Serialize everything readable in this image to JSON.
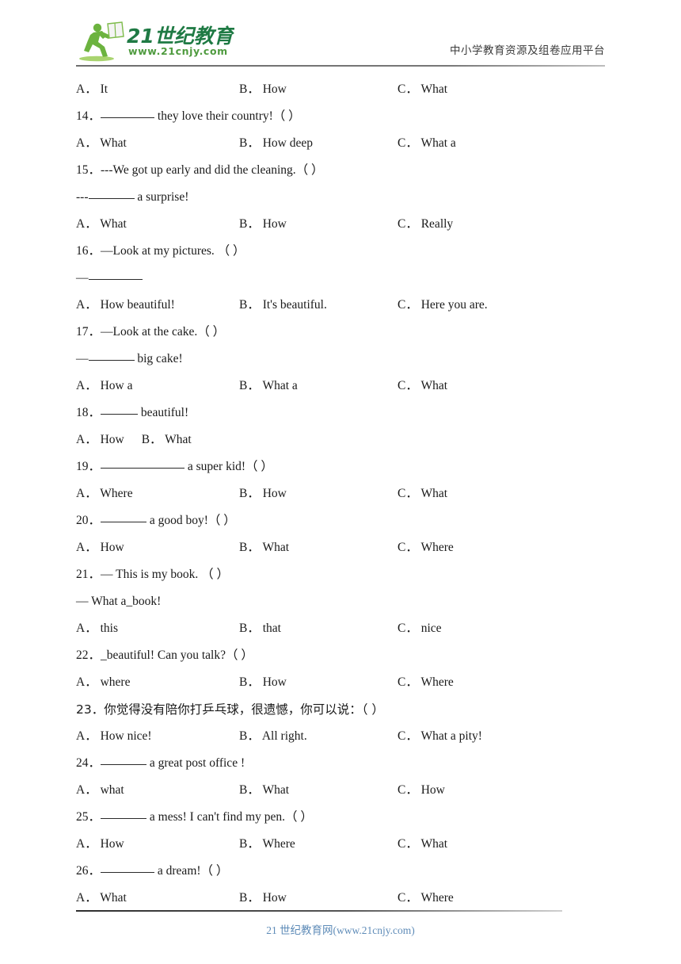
{
  "header": {
    "logo_brand": "21世纪教育",
    "logo_url": "www.21cnjy.com",
    "tagline": "中小学教育资源及组卷应用平台",
    "logo_colors": {
      "figure_green": "#6cb33f",
      "dark_green": "#1f7a44",
      "mid_green": "#4f9b3f",
      "book_fill": "#f2f2f2"
    }
  },
  "footer": {
    "text": "21 世纪教育网(www.21cnjy.com)",
    "color": "#5f8cb8"
  },
  "blocks": [
    {
      "kind": "options",
      "id": "opts-13",
      "layout": "three-col",
      "options": [
        {
          "letter": "A．",
          "text": "It"
        },
        {
          "letter": "B．",
          "text": "How"
        },
        {
          "letter": "C．",
          "text": "What"
        }
      ]
    },
    {
      "kind": "question",
      "id": "q14",
      "number": "14．",
      "pre": "",
      "blank": "w-lg",
      "post": "they love their country!（      ）"
    },
    {
      "kind": "options",
      "id": "opts-14",
      "layout": "three-col",
      "options": [
        {
          "letter": "A．",
          "text": "What"
        },
        {
          "letter": "B．",
          "text": "How deep"
        },
        {
          "letter": "C．",
          "text": "What a"
        }
      ]
    },
    {
      "kind": "text",
      "id": "q15",
      "text": "15．---We got up early and did the cleaning.（  ）"
    },
    {
      "kind": "question",
      "id": "q15b",
      "number": "---",
      "pre": "",
      "blank": "w-md",
      "post": "a surprise!"
    },
    {
      "kind": "options",
      "id": "opts-15",
      "layout": "three-col",
      "options": [
        {
          "letter": "A．",
          "text": "What"
        },
        {
          "letter": "B．",
          "text": "How"
        },
        {
          "letter": "C．",
          "text": "Really"
        }
      ]
    },
    {
      "kind": "text",
      "id": "q16",
      "text": "16．—Look at my pictures.  （  ）"
    },
    {
      "kind": "question",
      "id": "q16b",
      "number": "—",
      "pre": "",
      "blank": "w-lg",
      "post": ""
    },
    {
      "kind": "options",
      "id": "opts-16",
      "layout": "three-col",
      "options": [
        {
          "letter": "A．",
          "text": "How beautiful!"
        },
        {
          "letter": "B．",
          "text": "It's beautiful."
        },
        {
          "letter": "C．",
          "text": "Here you are."
        }
      ]
    },
    {
      "kind": "text",
      "id": "q17",
      "text": "17．—Look at the cake.（  ）"
    },
    {
      "kind": "question",
      "id": "q17b",
      "number": "—",
      "pre": "",
      "blank": "w-md",
      "post": "big cake!"
    },
    {
      "kind": "options",
      "id": "opts-17",
      "layout": "three-col",
      "options": [
        {
          "letter": "A．",
          "text": "How a"
        },
        {
          "letter": "B．",
          "text": "What a"
        },
        {
          "letter": "C．",
          "text": "What"
        }
      ]
    },
    {
      "kind": "question",
      "id": "q18",
      "number": "18．",
      "pre": "",
      "blank": "w-sm",
      "post": "beautiful!"
    },
    {
      "kind": "options",
      "id": "opts-18",
      "layout": "inline-two",
      "options": [
        {
          "letter": "A．",
          "text": "How"
        },
        {
          "letter": "B．",
          "text": "What"
        }
      ]
    },
    {
      "kind": "question",
      "id": "q19",
      "number": "19．",
      "pre": "",
      "blank": "w-xl",
      "post": "a super kid!（  ）"
    },
    {
      "kind": "options",
      "id": "opts-19",
      "layout": "three-col",
      "options": [
        {
          "letter": "A．",
          "text": "Where"
        },
        {
          "letter": "B．",
          "text": "How"
        },
        {
          "letter": "C．",
          "text": "What"
        }
      ]
    },
    {
      "kind": "question",
      "id": "q20",
      "number": "20．",
      "pre": "",
      "blank": "w-md",
      "post": "a good boy!（ ）"
    },
    {
      "kind": "options",
      "id": "opts-20",
      "layout": "three-col",
      "options": [
        {
          "letter": "A．",
          "text": "How"
        },
        {
          "letter": "B．",
          "text": "What"
        },
        {
          "letter": "C．",
          "text": "Where"
        }
      ]
    },
    {
      "kind": "text",
      "id": "q21",
      "text": "21．— This is my book.  （  ）"
    },
    {
      "kind": "text",
      "id": "q21b",
      "text": "— What a_book!"
    },
    {
      "kind": "options",
      "id": "opts-21",
      "layout": "three-col",
      "options": [
        {
          "letter": "A．",
          "text": "this"
        },
        {
          "letter": "B．",
          "text": "that"
        },
        {
          "letter": "C．",
          "text": "nice"
        }
      ]
    },
    {
      "kind": "text",
      "id": "q22",
      "text": "22．_beautiful! Can you talk?（  ）"
    },
    {
      "kind": "options",
      "id": "opts-22",
      "layout": "three-col",
      "options": [
        {
          "letter": "A．",
          "text": "where"
        },
        {
          "letter": "B．",
          "text": "How"
        },
        {
          "letter": "C．",
          "text": "Where"
        }
      ]
    },
    {
      "kind": "text-cn",
      "id": "q23",
      "text": "23．你觉得没有陪你打乒乓球，很遗憾，你可以说：（ ）"
    },
    {
      "kind": "options",
      "id": "opts-23",
      "layout": "three-col",
      "options": [
        {
          "letter": "A．",
          "text": "How nice!"
        },
        {
          "letter": "B．",
          "text": "All right."
        },
        {
          "letter": "C．",
          "text": "What a pity!"
        }
      ]
    },
    {
      "kind": "question",
      "id": "q24",
      "number": "24．",
      "pre": "",
      "blank": "w-md",
      "post": "a great post office  !"
    },
    {
      "kind": "options",
      "id": "opts-24",
      "layout": "three-col",
      "options": [
        {
          "letter": "A．",
          "text": "what"
        },
        {
          "letter": "B．",
          "text": "What"
        },
        {
          "letter": "C．",
          "text": "How"
        }
      ]
    },
    {
      "kind": "question",
      "id": "q25",
      "number": "25．",
      "pre": "",
      "blank": "w-md",
      "post": "a mess! I can't find my pen.（ ）"
    },
    {
      "kind": "options",
      "id": "opts-25",
      "layout": "three-col",
      "options": [
        {
          "letter": "A．",
          "text": "How"
        },
        {
          "letter": "B．",
          "text": "Where"
        },
        {
          "letter": "C．",
          "text": "What"
        }
      ]
    },
    {
      "kind": "question",
      "id": "q26",
      "number": "26．",
      "pre": "",
      "blank": "w-lg",
      "post": "a dream!（  ）"
    },
    {
      "kind": "options",
      "id": "opts-26",
      "layout": "three-col",
      "options": [
        {
          "letter": "A．",
          "text": "What"
        },
        {
          "letter": "B．",
          "text": "How"
        },
        {
          "letter": "C．",
          "text": "Where"
        }
      ]
    }
  ]
}
